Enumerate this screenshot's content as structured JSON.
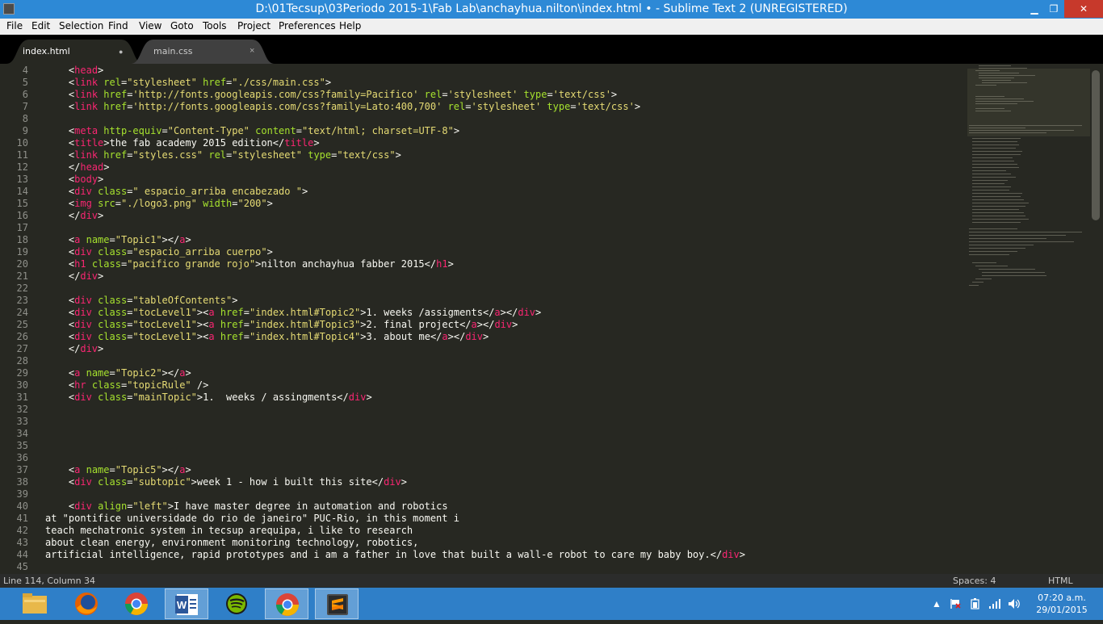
{
  "window": {
    "title": "D:\\01Tecsup\\03Periodo 2015-1\\Fab Lab\\anchayhua.nilton\\index.html • - Sublime Text 2 (UNREGISTERED)",
    "minimize": "▁",
    "maximize": "❐",
    "close": "✕"
  },
  "menu": [
    "File",
    "Edit",
    "Selection",
    "Find",
    "View",
    "Goto",
    "Tools",
    "Project",
    "Preferences",
    "Help"
  ],
  "tabs": [
    {
      "label": "index.html",
      "indicator": "●",
      "active": true
    },
    {
      "label": "main.css",
      "indicator": "×",
      "active": false
    }
  ],
  "line_numbers": [
    "4",
    "5",
    "6",
    "7",
    "8",
    "9",
    "10",
    "11",
    "12",
    "13",
    "14",
    "15",
    "16",
    "17",
    "18",
    "19",
    "20",
    "21",
    "22",
    "23",
    "24",
    "25",
    "26",
    "27",
    "28",
    "29",
    "30",
    "31",
    "32",
    "33",
    "34",
    "35",
    "36",
    "37",
    "38",
    "39",
    "40",
    "41",
    "42",
    "43",
    "44",
    "45"
  ],
  "code_lines": [
    [
      [
        "    ",
        "pun"
      ],
      [
        "<",
        "pun"
      ],
      [
        "head",
        "tag"
      ],
      [
        ">",
        "pun"
      ]
    ],
    [
      [
        "    ",
        "pun"
      ],
      [
        "<",
        "pun"
      ],
      [
        "link",
        "tag"
      ],
      [
        " ",
        "pun"
      ],
      [
        "rel",
        "attr"
      ],
      [
        "=",
        "pun"
      ],
      [
        "\"stylesheet\"",
        "str"
      ],
      [
        " ",
        "pun"
      ],
      [
        "href",
        "attr"
      ],
      [
        "=",
        "pun"
      ],
      [
        "\"./css/main.css\"",
        "str"
      ],
      [
        ">",
        "pun"
      ]
    ],
    [
      [
        "    ",
        "pun"
      ],
      [
        "<",
        "pun"
      ],
      [
        "link",
        "tag"
      ],
      [
        " ",
        "pun"
      ],
      [
        "href",
        "attr"
      ],
      [
        "=",
        "pun"
      ],
      [
        "'http://fonts.googleapis.com/css?family=Pacifico'",
        "str"
      ],
      [
        " ",
        "pun"
      ],
      [
        "rel",
        "attr"
      ],
      [
        "=",
        "pun"
      ],
      [
        "'stylesheet'",
        "str"
      ],
      [
        " ",
        "pun"
      ],
      [
        "type",
        "attr"
      ],
      [
        "=",
        "pun"
      ],
      [
        "'text/css'",
        "str"
      ],
      [
        ">",
        "pun"
      ]
    ],
    [
      [
        "    ",
        "pun"
      ],
      [
        "<",
        "pun"
      ],
      [
        "link",
        "tag"
      ],
      [
        " ",
        "pun"
      ],
      [
        "href",
        "attr"
      ],
      [
        "=",
        "pun"
      ],
      [
        "'http://fonts.googleapis.com/css?family=Lato:400,700'",
        "str"
      ],
      [
        " ",
        "pun"
      ],
      [
        "rel",
        "attr"
      ],
      [
        "=",
        "pun"
      ],
      [
        "'stylesheet'",
        "str"
      ],
      [
        " ",
        "pun"
      ],
      [
        "type",
        "attr"
      ],
      [
        "=",
        "pun"
      ],
      [
        "'text/css'",
        "str"
      ],
      [
        ">",
        "pun"
      ]
    ],
    [],
    [
      [
        "    ",
        "pun"
      ],
      [
        "<",
        "pun"
      ],
      [
        "meta",
        "tag"
      ],
      [
        " ",
        "pun"
      ],
      [
        "http-equiv",
        "attr"
      ],
      [
        "=",
        "pun"
      ],
      [
        "\"Content-Type\"",
        "str"
      ],
      [
        " ",
        "pun"
      ],
      [
        "content",
        "attr"
      ],
      [
        "=",
        "pun"
      ],
      [
        "\"text/html; charset=UTF-8\"",
        "str"
      ],
      [
        ">",
        "pun"
      ]
    ],
    [
      [
        "    ",
        "pun"
      ],
      [
        "<",
        "pun"
      ],
      [
        "title",
        "tag"
      ],
      [
        ">the fab academy 2015 edition</",
        "pun"
      ],
      [
        "title",
        "tag"
      ],
      [
        ">",
        "pun"
      ]
    ],
    [
      [
        "    ",
        "pun"
      ],
      [
        "<",
        "pun"
      ],
      [
        "link",
        "tag"
      ],
      [
        " ",
        "pun"
      ],
      [
        "href",
        "attr"
      ],
      [
        "=",
        "pun"
      ],
      [
        "\"styles.css\"",
        "str"
      ],
      [
        " ",
        "pun"
      ],
      [
        "rel",
        "attr"
      ],
      [
        "=",
        "pun"
      ],
      [
        "\"stylesheet\"",
        "str"
      ],
      [
        " ",
        "pun"
      ],
      [
        "type",
        "attr"
      ],
      [
        "=",
        "pun"
      ],
      [
        "\"text/css\"",
        "str"
      ],
      [
        ">",
        "pun"
      ]
    ],
    [
      [
        "    ",
        "pun"
      ],
      [
        "</",
        "pun"
      ],
      [
        "head",
        "tag"
      ],
      [
        ">",
        "pun"
      ]
    ],
    [
      [
        "    ",
        "pun"
      ],
      [
        "<",
        "pun"
      ],
      [
        "body",
        "tag"
      ],
      [
        ">",
        "pun"
      ]
    ],
    [
      [
        "    ",
        "pun"
      ],
      [
        "<",
        "pun"
      ],
      [
        "div",
        "tag"
      ],
      [
        " ",
        "pun"
      ],
      [
        "class",
        "attr"
      ],
      [
        "=",
        "pun"
      ],
      [
        "\" espacio_arriba encabezado \"",
        "str"
      ],
      [
        ">",
        "pun"
      ]
    ],
    [
      [
        "    ",
        "pun"
      ],
      [
        "<",
        "pun"
      ],
      [
        "img",
        "tag"
      ],
      [
        " ",
        "pun"
      ],
      [
        "src",
        "attr"
      ],
      [
        "=",
        "pun"
      ],
      [
        "\"./logo3.png\"",
        "str"
      ],
      [
        " ",
        "pun"
      ],
      [
        "width",
        "attr"
      ],
      [
        "=",
        "pun"
      ],
      [
        "\"200\"",
        "str"
      ],
      [
        ">",
        "pun"
      ]
    ],
    [
      [
        "    ",
        "pun"
      ],
      [
        "</",
        "pun"
      ],
      [
        "div",
        "tag"
      ],
      [
        ">",
        "pun"
      ]
    ],
    [],
    [
      [
        "    ",
        "pun"
      ],
      [
        "<",
        "pun"
      ],
      [
        "a",
        "tag"
      ],
      [
        " ",
        "pun"
      ],
      [
        "name",
        "attr"
      ],
      [
        "=",
        "pun"
      ],
      [
        "\"Topic1\"",
        "str"
      ],
      [
        "></",
        "pun"
      ],
      [
        "a",
        "tag"
      ],
      [
        ">",
        "pun"
      ]
    ],
    [
      [
        "    ",
        "pun"
      ],
      [
        "<",
        "pun"
      ],
      [
        "div",
        "tag"
      ],
      [
        " ",
        "pun"
      ],
      [
        "class",
        "attr"
      ],
      [
        "=",
        "pun"
      ],
      [
        "\"espacio_arriba cuerpo\"",
        "str"
      ],
      [
        ">",
        "pun"
      ]
    ],
    [
      [
        "    ",
        "pun"
      ],
      [
        "<",
        "pun"
      ],
      [
        "h1",
        "tag"
      ],
      [
        " ",
        "pun"
      ],
      [
        "class",
        "attr"
      ],
      [
        "=",
        "pun"
      ],
      [
        "\"pacifico grande rojo\"",
        "str"
      ],
      [
        ">nilton anchayhua fabber 2015</",
        "pun"
      ],
      [
        "h1",
        "tag"
      ],
      [
        ">",
        "pun"
      ]
    ],
    [
      [
        "    ",
        "pun"
      ],
      [
        "</",
        "pun"
      ],
      [
        "div",
        "tag"
      ],
      [
        ">",
        "pun"
      ]
    ],
    [],
    [
      [
        "    ",
        "pun"
      ],
      [
        "<",
        "pun"
      ],
      [
        "div",
        "tag"
      ],
      [
        " ",
        "pun"
      ],
      [
        "class",
        "attr"
      ],
      [
        "=",
        "pun"
      ],
      [
        "\"tableOfContents\"",
        "str"
      ],
      [
        ">",
        "pun"
      ]
    ],
    [
      [
        "    ",
        "pun"
      ],
      [
        "<",
        "pun"
      ],
      [
        "div",
        "tag"
      ],
      [
        " ",
        "pun"
      ],
      [
        "class",
        "attr"
      ],
      [
        "=",
        "pun"
      ],
      [
        "\"tocLevel1\"",
        "str"
      ],
      [
        "><",
        "pun"
      ],
      [
        "a",
        "tag"
      ],
      [
        " ",
        "pun"
      ],
      [
        "href",
        "attr"
      ],
      [
        "=",
        "pun"
      ],
      [
        "\"index.html#Topic2\"",
        "str"
      ],
      [
        ">1. weeks /assigments</",
        "pun"
      ],
      [
        "a",
        "tag"
      ],
      [
        "></",
        "pun"
      ],
      [
        "div",
        "tag"
      ],
      [
        ">",
        "pun"
      ]
    ],
    [
      [
        "    ",
        "pun"
      ],
      [
        "<",
        "pun"
      ],
      [
        "div",
        "tag"
      ],
      [
        " ",
        "pun"
      ],
      [
        "class",
        "attr"
      ],
      [
        "=",
        "pun"
      ],
      [
        "\"tocLevel1\"",
        "str"
      ],
      [
        "><",
        "pun"
      ],
      [
        "a",
        "tag"
      ],
      [
        " ",
        "pun"
      ],
      [
        "href",
        "attr"
      ],
      [
        "=",
        "pun"
      ],
      [
        "\"index.html#Topic3\"",
        "str"
      ],
      [
        ">2. final project</",
        "pun"
      ],
      [
        "a",
        "tag"
      ],
      [
        "></",
        "pun"
      ],
      [
        "div",
        "tag"
      ],
      [
        ">",
        "pun"
      ]
    ],
    [
      [
        "    ",
        "pun"
      ],
      [
        "<",
        "pun"
      ],
      [
        "div",
        "tag"
      ],
      [
        " ",
        "pun"
      ],
      [
        "class",
        "attr"
      ],
      [
        "=",
        "pun"
      ],
      [
        "\"tocLevel1\"",
        "str"
      ],
      [
        "><",
        "pun"
      ],
      [
        "a",
        "tag"
      ],
      [
        " ",
        "pun"
      ],
      [
        "href",
        "attr"
      ],
      [
        "=",
        "pun"
      ],
      [
        "\"index.html#Topic4\"",
        "str"
      ],
      [
        ">3. about me</",
        "pun"
      ],
      [
        "a",
        "tag"
      ],
      [
        "></",
        "pun"
      ],
      [
        "div",
        "tag"
      ],
      [
        ">",
        "pun"
      ]
    ],
    [
      [
        "    ",
        "pun"
      ],
      [
        "</",
        "pun"
      ],
      [
        "div",
        "tag"
      ],
      [
        ">",
        "pun"
      ]
    ],
    [],
    [
      [
        "    ",
        "pun"
      ],
      [
        "<",
        "pun"
      ],
      [
        "a",
        "tag"
      ],
      [
        " ",
        "pun"
      ],
      [
        "name",
        "attr"
      ],
      [
        "=",
        "pun"
      ],
      [
        "\"Topic2\"",
        "str"
      ],
      [
        "></",
        "pun"
      ],
      [
        "a",
        "tag"
      ],
      [
        ">",
        "pun"
      ]
    ],
    [
      [
        "    ",
        "pun"
      ],
      [
        "<",
        "pun"
      ],
      [
        "hr",
        "tag"
      ],
      [
        " ",
        "pun"
      ],
      [
        "class",
        "attr"
      ],
      [
        "=",
        "pun"
      ],
      [
        "\"topicRule\"",
        "str"
      ],
      [
        " />",
        "pun"
      ]
    ],
    [
      [
        "    ",
        "pun"
      ],
      [
        "<",
        "pun"
      ],
      [
        "div",
        "tag"
      ],
      [
        " ",
        "pun"
      ],
      [
        "class",
        "attr"
      ],
      [
        "=",
        "pun"
      ],
      [
        "\"mainTopic\"",
        "str"
      ],
      [
        ">1.  weeks / assingments</",
        "pun"
      ],
      [
        "div",
        "tag"
      ],
      [
        ">",
        "pun"
      ]
    ],
    [],
    [],
    [],
    [],
    [],
    [
      [
        "    ",
        "pun"
      ],
      [
        "<",
        "pun"
      ],
      [
        "a",
        "tag"
      ],
      [
        " ",
        "pun"
      ],
      [
        "name",
        "attr"
      ],
      [
        "=",
        "pun"
      ],
      [
        "\"Topic5\"",
        "str"
      ],
      [
        "></",
        "pun"
      ],
      [
        "a",
        "tag"
      ],
      [
        ">",
        "pun"
      ]
    ],
    [
      [
        "    ",
        "pun"
      ],
      [
        "<",
        "pun"
      ],
      [
        "div",
        "tag"
      ],
      [
        " ",
        "pun"
      ],
      [
        "class",
        "attr"
      ],
      [
        "=",
        "pun"
      ],
      [
        "\"subtopic\"",
        "str"
      ],
      [
        ">week 1 - how i built this site</",
        "pun"
      ],
      [
        "div",
        "tag"
      ],
      [
        ">",
        "pun"
      ]
    ],
    [],
    [
      [
        "    ",
        "pun"
      ],
      [
        "<",
        "pun"
      ],
      [
        "div",
        "tag"
      ],
      [
        " ",
        "pun"
      ],
      [
        "align",
        "attr"
      ],
      [
        "=",
        "pun"
      ],
      [
        "\"left\"",
        "str"
      ],
      [
        ">I have master degree in automation and robotics",
        "pun"
      ]
    ],
    [
      [
        "at \"pontifice universidade do rio de janeiro\" PUC-Rio, in this moment i",
        "pun"
      ]
    ],
    [
      [
        "teach mechatronic system in tecsup arequipa, i like to research",
        "pun"
      ]
    ],
    [
      [
        "about clean energy, environment monitoring technology, robotics,",
        "pun"
      ]
    ],
    [
      [
        "artificial intelligence, rapid prototypes and i am a father in love that built a wall-e robot to care my baby boy.</",
        "pun"
      ],
      [
        "div",
        "tag"
      ],
      [
        ">",
        "pun"
      ]
    ],
    []
  ],
  "statusbar": {
    "position": "Line 114, Column 34",
    "spaces": "Spaces: 4",
    "syntax": "HTML"
  },
  "taskbar": {
    "apps": [
      "folder-icon",
      "firefox-icon",
      "chrome-icon",
      "word-icon",
      "spotify-icon",
      "chrome-icon",
      "sublime-icon"
    ],
    "time": "07:20 a.m.",
    "date": "29/01/2015"
  },
  "colors": {
    "editor_bg": "#272822",
    "tag": "#f92672",
    "attr": "#a6e22e",
    "string": "#e6db74",
    "text": "#f8f8f2",
    "titlebar": "#2d89d6",
    "taskbar": "#2f7fc8"
  }
}
